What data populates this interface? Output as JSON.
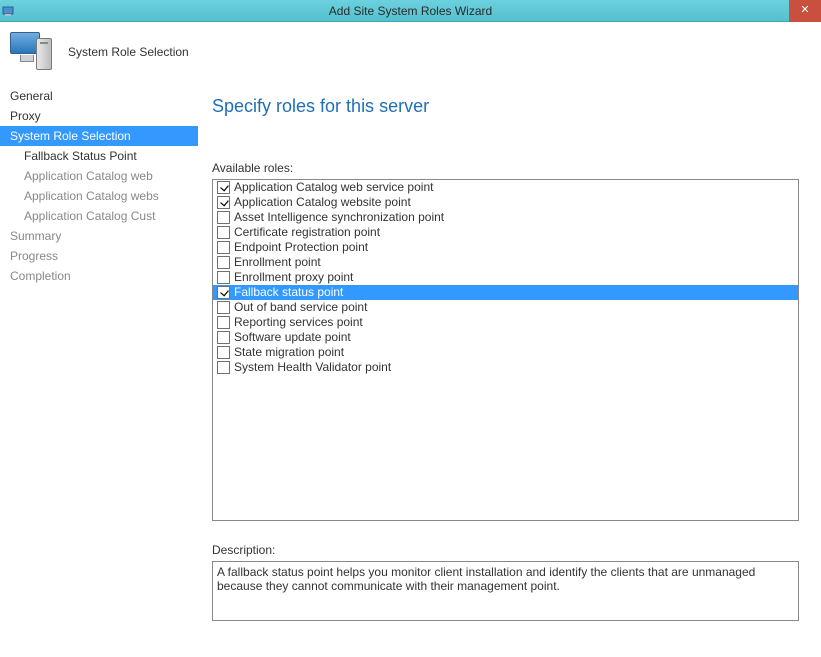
{
  "window": {
    "title": "Add Site System Roles Wizard",
    "close_glyph": "✕"
  },
  "header": {
    "title": "System Role Selection"
  },
  "sidebar": {
    "items": [
      {
        "label": "General",
        "sub": false,
        "active": false,
        "disabled": false
      },
      {
        "label": "Proxy",
        "sub": false,
        "active": false,
        "disabled": false
      },
      {
        "label": "System Role Selection",
        "sub": false,
        "active": true,
        "disabled": false
      },
      {
        "label": "Fallback Status Point",
        "sub": true,
        "active": false,
        "disabled": false
      },
      {
        "label": "Application Catalog web",
        "sub": true,
        "active": false,
        "disabled": true
      },
      {
        "label": "Application Catalog webs",
        "sub": true,
        "active": false,
        "disabled": true
      },
      {
        "label": "Application Catalog Cust",
        "sub": true,
        "active": false,
        "disabled": true
      },
      {
        "label": "Summary",
        "sub": false,
        "active": false,
        "disabled": true
      },
      {
        "label": "Progress",
        "sub": false,
        "active": false,
        "disabled": true
      },
      {
        "label": "Completion",
        "sub": false,
        "active": false,
        "disabled": true
      }
    ]
  },
  "main": {
    "heading": "Specify roles for this server",
    "available_label": "Available roles:",
    "roles": [
      {
        "label": "Application Catalog web service point",
        "checked": true,
        "selected": false
      },
      {
        "label": "Application Catalog website point",
        "checked": true,
        "selected": false
      },
      {
        "label": "Asset Intelligence synchronization point",
        "checked": false,
        "selected": false
      },
      {
        "label": "Certificate registration point",
        "checked": false,
        "selected": false
      },
      {
        "label": "Endpoint Protection point",
        "checked": false,
        "selected": false
      },
      {
        "label": "Enrollment point",
        "checked": false,
        "selected": false
      },
      {
        "label": "Enrollment proxy point",
        "checked": false,
        "selected": false
      },
      {
        "label": "Fallback status point",
        "checked": true,
        "selected": true
      },
      {
        "label": "Out of band service point",
        "checked": false,
        "selected": false
      },
      {
        "label": "Reporting services point",
        "checked": false,
        "selected": false
      },
      {
        "label": "Software update point",
        "checked": false,
        "selected": false
      },
      {
        "label": "State migration point",
        "checked": false,
        "selected": false
      },
      {
        "label": "System Health Validator point",
        "checked": false,
        "selected": false
      }
    ],
    "description_label": "Description:",
    "description_text": "A fallback status point helps you monitor client installation and identify the clients that are unmanaged because they cannot communicate with their management point."
  }
}
